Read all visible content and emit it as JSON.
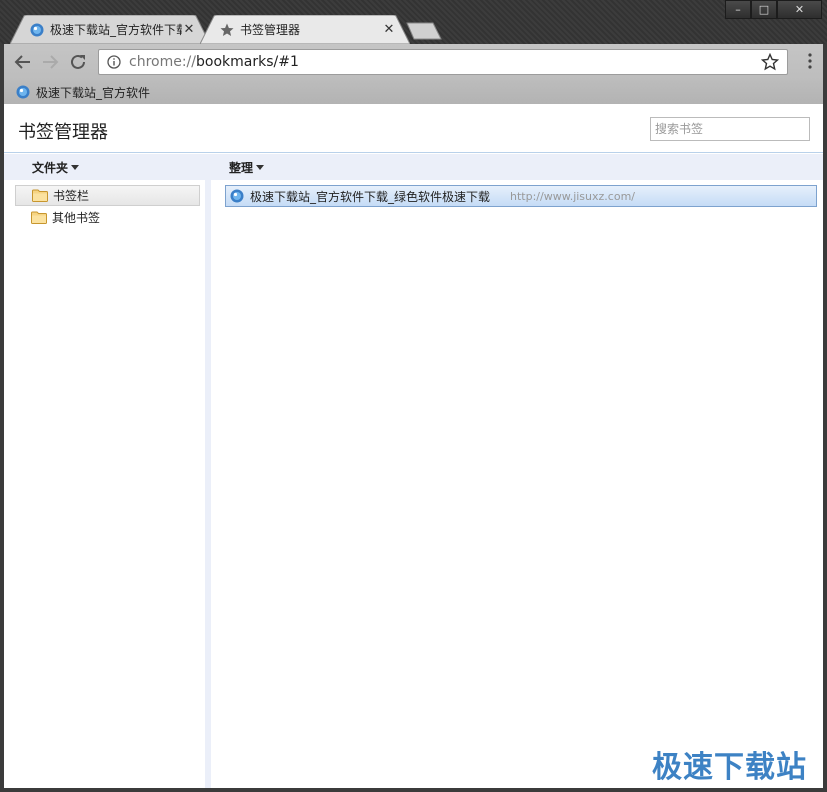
{
  "tabs": [
    {
      "title": "极速下载站_官方软件下载_绿色软件极速下载",
      "active": false
    },
    {
      "title": "书签管理器",
      "active": true
    }
  ],
  "window_controls": {
    "minimize": "–",
    "maximize": "□",
    "close": "✕"
  },
  "omnibox": {
    "scheme": "chrome://",
    "rest": "bookmarks/#1"
  },
  "bookmarks_bar": {
    "items": [
      {
        "label": "极速下载站_官方软件"
      }
    ]
  },
  "page": {
    "title": "书签管理器",
    "search_placeholder": "搜索书签",
    "menus": {
      "folders": "文件夹",
      "organize": "整理"
    },
    "tree": [
      {
        "label": "书签栏",
        "selected": true
      },
      {
        "label": "其他书签",
        "selected": false
      }
    ],
    "list": [
      {
        "title": "极速下载站_官方软件下载_绿色软件极速下载",
        "url": "http://www.jisuxz.com/"
      }
    ]
  },
  "watermark": "极速下载站",
  "colors": {
    "accent": "#3d82c4",
    "selection": "#c5dcf6",
    "menubar": "#ebeff9"
  }
}
